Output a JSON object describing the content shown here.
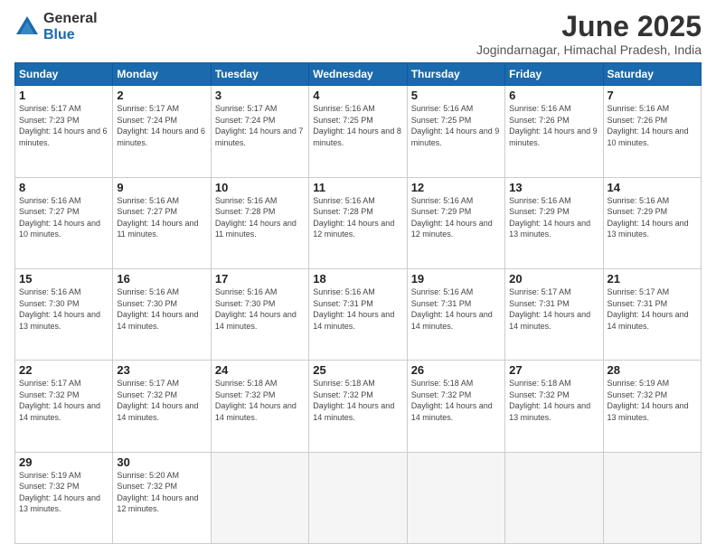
{
  "logo": {
    "general": "General",
    "blue": "Blue"
  },
  "title": {
    "month": "June 2025",
    "location": "Jogindarnagar, Himachal Pradesh, India"
  },
  "headers": [
    "Sunday",
    "Monday",
    "Tuesday",
    "Wednesday",
    "Thursday",
    "Friday",
    "Saturday"
  ],
  "weeks": [
    [
      {
        "day": "1",
        "sunrise": "5:17 AM",
        "sunset": "7:23 PM",
        "daylight": "14 hours and 6 minutes."
      },
      {
        "day": "2",
        "sunrise": "5:17 AM",
        "sunset": "7:24 PM",
        "daylight": "14 hours and 6 minutes."
      },
      {
        "day": "3",
        "sunrise": "5:17 AM",
        "sunset": "7:24 PM",
        "daylight": "14 hours and 7 minutes."
      },
      {
        "day": "4",
        "sunrise": "5:16 AM",
        "sunset": "7:25 PM",
        "daylight": "14 hours and 8 minutes."
      },
      {
        "day": "5",
        "sunrise": "5:16 AM",
        "sunset": "7:25 PM",
        "daylight": "14 hours and 9 minutes."
      },
      {
        "day": "6",
        "sunrise": "5:16 AM",
        "sunset": "7:26 PM",
        "daylight": "14 hours and 9 minutes."
      },
      {
        "day": "7",
        "sunrise": "5:16 AM",
        "sunset": "7:26 PM",
        "daylight": "14 hours and 10 minutes."
      }
    ],
    [
      {
        "day": "8",
        "sunrise": "5:16 AM",
        "sunset": "7:27 PM",
        "daylight": "14 hours and 10 minutes."
      },
      {
        "day": "9",
        "sunrise": "5:16 AM",
        "sunset": "7:27 PM",
        "daylight": "14 hours and 11 minutes."
      },
      {
        "day": "10",
        "sunrise": "5:16 AM",
        "sunset": "7:28 PM",
        "daylight": "14 hours and 11 minutes."
      },
      {
        "day": "11",
        "sunrise": "5:16 AM",
        "sunset": "7:28 PM",
        "daylight": "14 hours and 12 minutes."
      },
      {
        "day": "12",
        "sunrise": "5:16 AM",
        "sunset": "7:29 PM",
        "daylight": "14 hours and 12 minutes."
      },
      {
        "day": "13",
        "sunrise": "5:16 AM",
        "sunset": "7:29 PM",
        "daylight": "14 hours and 13 minutes."
      },
      {
        "day": "14",
        "sunrise": "5:16 AM",
        "sunset": "7:29 PM",
        "daylight": "14 hours and 13 minutes."
      }
    ],
    [
      {
        "day": "15",
        "sunrise": "5:16 AM",
        "sunset": "7:30 PM",
        "daylight": "14 hours and 13 minutes."
      },
      {
        "day": "16",
        "sunrise": "5:16 AM",
        "sunset": "7:30 PM",
        "daylight": "14 hours and 14 minutes."
      },
      {
        "day": "17",
        "sunrise": "5:16 AM",
        "sunset": "7:30 PM",
        "daylight": "14 hours and 14 minutes."
      },
      {
        "day": "18",
        "sunrise": "5:16 AM",
        "sunset": "7:31 PM",
        "daylight": "14 hours and 14 minutes."
      },
      {
        "day": "19",
        "sunrise": "5:16 AM",
        "sunset": "7:31 PM",
        "daylight": "14 hours and 14 minutes."
      },
      {
        "day": "20",
        "sunrise": "5:17 AM",
        "sunset": "7:31 PM",
        "daylight": "14 hours and 14 minutes."
      },
      {
        "day": "21",
        "sunrise": "5:17 AM",
        "sunset": "7:31 PM",
        "daylight": "14 hours and 14 minutes."
      }
    ],
    [
      {
        "day": "22",
        "sunrise": "5:17 AM",
        "sunset": "7:32 PM",
        "daylight": "14 hours and 14 minutes."
      },
      {
        "day": "23",
        "sunrise": "5:17 AM",
        "sunset": "7:32 PM",
        "daylight": "14 hours and 14 minutes."
      },
      {
        "day": "24",
        "sunrise": "5:18 AM",
        "sunset": "7:32 PM",
        "daylight": "14 hours and 14 minutes."
      },
      {
        "day": "25",
        "sunrise": "5:18 AM",
        "sunset": "7:32 PM",
        "daylight": "14 hours and 14 minutes."
      },
      {
        "day": "26",
        "sunrise": "5:18 AM",
        "sunset": "7:32 PM",
        "daylight": "14 hours and 14 minutes."
      },
      {
        "day": "27",
        "sunrise": "5:18 AM",
        "sunset": "7:32 PM",
        "daylight": "14 hours and 13 minutes."
      },
      {
        "day": "28",
        "sunrise": "5:19 AM",
        "sunset": "7:32 PM",
        "daylight": "14 hours and 13 minutes."
      }
    ],
    [
      {
        "day": "29",
        "sunrise": "5:19 AM",
        "sunset": "7:32 PM",
        "daylight": "14 hours and 13 minutes."
      },
      {
        "day": "30",
        "sunrise": "5:20 AM",
        "sunset": "7:32 PM",
        "daylight": "14 hours and 12 minutes."
      },
      null,
      null,
      null,
      null,
      null
    ]
  ]
}
